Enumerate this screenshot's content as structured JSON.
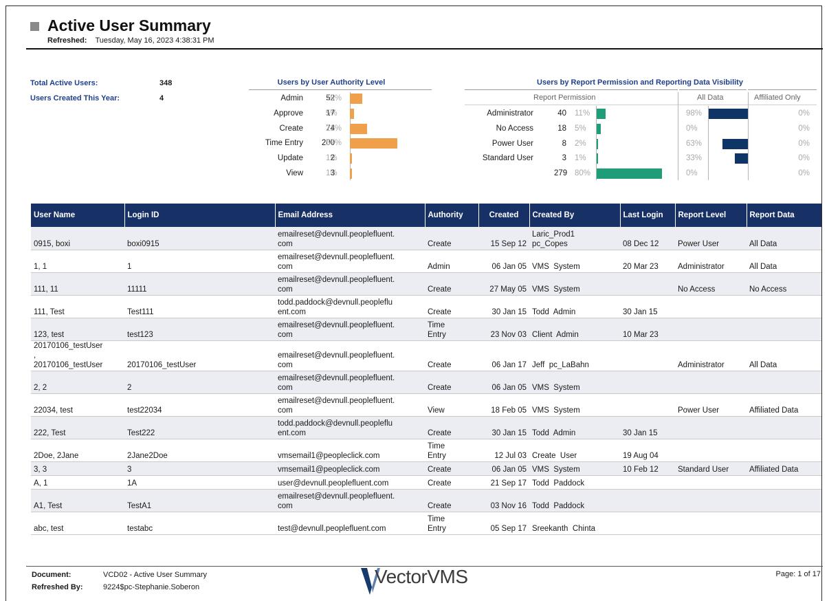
{
  "header": {
    "title": "Active User Summary",
    "refreshed_label": "Refreshed:",
    "refreshed_value": "Tuesday, May 16, 2023  4:38:31 PM"
  },
  "stats": {
    "total_label": "Total Active Users:",
    "total_value": "348",
    "created_label": "Users Created This Year:",
    "created_value": "4"
  },
  "authority_chart": {
    "title": "Users by User Authority Level",
    "rows": [
      {
        "label": "Admin",
        "count": "52",
        "pct": "15%",
        "value": 15
      },
      {
        "label": "Approve",
        "count": "17",
        "pct": "5%",
        "value": 5
      },
      {
        "label": "Create",
        "count": "74",
        "pct": "21%",
        "value": 21
      },
      {
        "label": "Time Entry",
        "count": "200",
        "pct": "57%",
        "value": 57
      },
      {
        "label": "Update",
        "count": "2",
        "pct": "1%",
        "value": 1
      },
      {
        "label": "View",
        "count": "3",
        "pct": "1%",
        "value": 1
      }
    ],
    "bar_color": "#f0a04b"
  },
  "permission_chart": {
    "title": "Users by Report Permission and Reporting Data Visibility",
    "col_permission": "Report Permission",
    "col_all": "All Data",
    "col_affiliated": "Affiliated Only",
    "rows": [
      {
        "label": "Administrator",
        "count": "40",
        "pct": "11%",
        "value": 11,
        "all_pct": "98%",
        "all_value": 98,
        "aff_pct": "0%"
      },
      {
        "label": "No Access",
        "count": "18",
        "pct": "5%",
        "value": 5,
        "all_pct": "0%",
        "all_value": 0,
        "aff_pct": "0%"
      },
      {
        "label": "Power User",
        "count": "8",
        "pct": "2%",
        "value": 2,
        "all_pct": "63%",
        "all_value": 63,
        "aff_pct": "0%"
      },
      {
        "label": "Standard User",
        "count": "3",
        "pct": "1%",
        "value": 1,
        "all_pct": "33%",
        "all_value": 33,
        "aff_pct": "0%"
      },
      {
        "label": "",
        "count": "279",
        "pct": "80%",
        "value": 80,
        "all_pct": "0%",
        "all_value": 0,
        "aff_pct": "0%"
      }
    ],
    "green_color": "#1e9d78",
    "navy_color": "#0e3566"
  },
  "table": {
    "columns": [
      "User Name",
      "Login ID",
      "Email Address",
      "Authority",
      "Created",
      "Created By",
      "Last Login",
      "Report Level",
      "Report Data"
    ],
    "rows": [
      [
        "0915, boxi",
        "boxi0915",
        "emailreset@devnull.peoplefluent.\ncom",
        "Create",
        "15 Sep 12",
        "Laric_Prod1\npc_Copes",
        "08 Dec 12",
        "Power User",
        "All Data"
      ],
      [
        "1, 1",
        "1",
        "emailreset@devnull.peoplefluent.\ncom",
        "Admin",
        "06 Jan 05",
        "VMS  System",
        "20 Mar 23",
        "Administrator",
        "All Data"
      ],
      [
        "111, 11",
        "11111",
        "emailreset@devnull.peoplefluent.\ncom",
        "Create",
        "27 May 05",
        "VMS  System",
        "",
        "No Access",
        "No Access"
      ],
      [
        "111, Test",
        "Test111",
        "todd.paddock@devnull.peopleflu\nent.com",
        "Create",
        "30 Jan 15",
        "Todd  Admin",
        "30 Jan 15",
        "",
        ""
      ],
      [
        "123, test",
        "test123",
        "emailreset@devnull.peoplefluent.\ncom",
        "Time\nEntry",
        "23 Nov 03",
        "Client  Admin",
        "10 Mar 23",
        "",
        ""
      ],
      [
        "20170106_testUser\n,\n20170106_testUser",
        "20170106_testUser",
        "emailreset@devnull.peoplefluent.\ncom",
        "Create",
        "06 Jan 17",
        "Jeff  pc_LaBahn",
        "",
        "Administrator",
        "All Data"
      ],
      [
        "2, 2",
        "2",
        "emailreset@devnull.peoplefluent.\ncom",
        "Create",
        "06 Jan 05",
        "VMS  System",
        "",
        "",
        ""
      ],
      [
        "22034, test",
        "test22034",
        "emailreset@devnull.peoplefluent.\ncom",
        "View",
        "18 Feb 05",
        "VMS  System",
        "",
        "Power User",
        "Affiliated Data"
      ],
      [
        "222, Test",
        "Test222",
        "todd.paddock@devnull.peopleflu\nent.com",
        "Create",
        "30 Jan 15",
        "Todd  Admin",
        "30 Jan 15",
        "",
        ""
      ],
      [
        "2Doe, 2Jane",
        "2Jane2Doe",
        "vmsemail1@peopleclick.com",
        "Time\nEntry",
        "12 Jul 03",
        "Create  User",
        "19 Aug 04",
        "",
        ""
      ],
      [
        "3, 3",
        "3",
        "vmsemail1@peopleclick.com",
        "Create",
        "06 Jan 05",
        "VMS  System",
        "10 Feb 12",
        "Standard User",
        "Affiliated Data"
      ],
      [
        "A, 1",
        "1A",
        "user@devnull.peoplefluent.com",
        "Create",
        "21 Sep 17",
        "Todd  Paddock",
        "",
        "",
        ""
      ],
      [
        "A1, Test",
        "TestA1",
        "emailreset@devnull.peoplefluent.\ncom",
        "Create",
        "03 Nov 16",
        "Todd  Paddock",
        "",
        "",
        ""
      ],
      [
        "abc, test",
        "testabc",
        "test@devnull.peoplefluent.com",
        "Time\nEntry",
        "05 Sep 17",
        "Sreekanth  Chinta",
        "",
        "",
        ""
      ]
    ]
  },
  "footer": {
    "document_label": "Document:",
    "document_value": "VCD02 - Active User Summary",
    "refreshed_by_label": "Refreshed By:",
    "refreshed_by_value": "9224$pc-Stephanie.Soberon",
    "logo_text": "VectorVMS",
    "page": "Page: 1 of 17"
  }
}
